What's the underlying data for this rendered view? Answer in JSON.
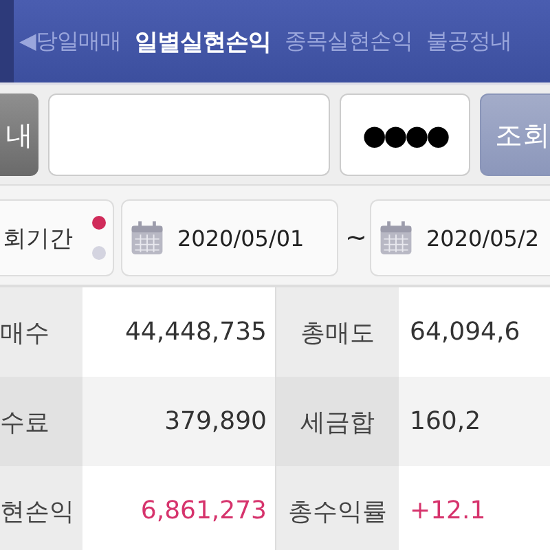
{
  "tabs": [
    {
      "label": "◀당일매매",
      "selected": false
    },
    {
      "label": "일별실현손익",
      "selected": true
    },
    {
      "label": "종목실현손익",
      "selected": false
    },
    {
      "label": "불공정내",
      "selected": false
    }
  ],
  "account": {
    "button": "내",
    "password": "●●●●",
    "query_button": "조회"
  },
  "period": {
    "label": "회기간",
    "dots": [
      {
        "selected": true
      },
      {
        "selected": false
      }
    ],
    "start": "2020/05/01",
    "separator": "~",
    "end": "2020/05/2"
  },
  "summary": [
    {
      "cells": [
        {
          "label": "매수",
          "value": "44,448,735",
          "positive": false
        },
        {
          "label": "총매도",
          "value": "64,094,6",
          "positive": false
        }
      ]
    },
    {
      "cells": [
        {
          "label": "수료",
          "value": "379,890",
          "positive": false
        },
        {
          "label": "세금합",
          "value": "160,2",
          "positive": false
        }
      ]
    },
    {
      "cells": [
        {
          "label": "현손익",
          "value": "6,861,273",
          "positive": true
        },
        {
          "label": "총수익률",
          "value": "+12.1",
          "positive": true
        }
      ]
    }
  ]
}
